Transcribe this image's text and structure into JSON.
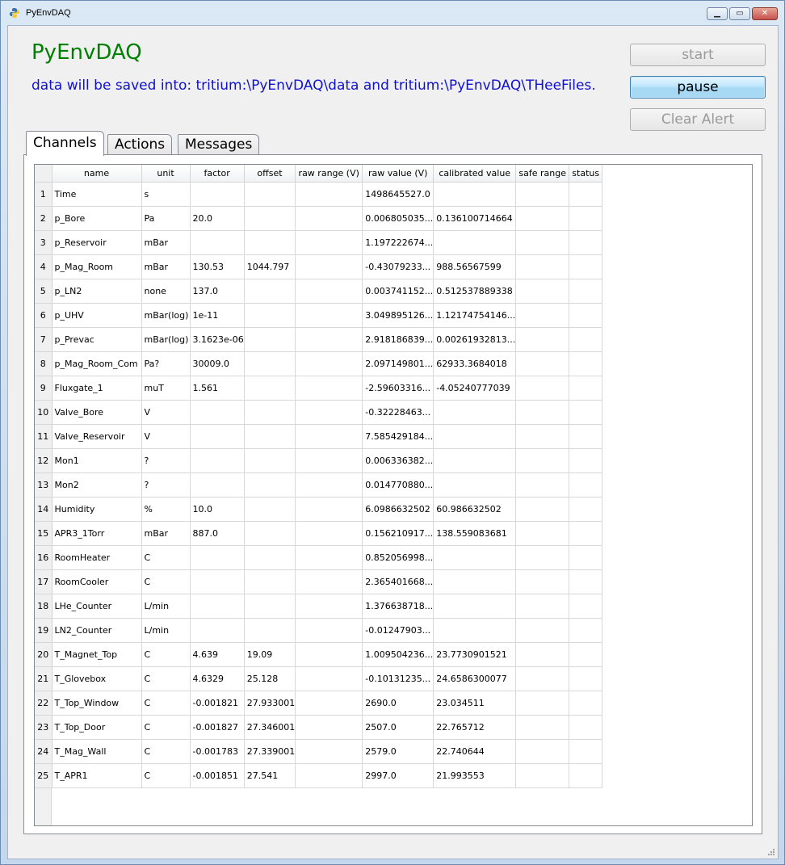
{
  "window": {
    "title": "PyEnvDAQ"
  },
  "header": {
    "app_title": "PyEnvDAQ",
    "save_info": "data will be saved into: tritium:\\PyEnvDAQ\\data and tritium:\\PyEnvDAQ\\THeeFiles."
  },
  "buttons": {
    "start": "start",
    "pause": "pause",
    "clear_alert": "Clear Alert"
  },
  "tabs": [
    {
      "label": "Channels",
      "active": true
    },
    {
      "label": "Actions",
      "active": false
    },
    {
      "label": "Messages",
      "active": false
    }
  ],
  "table": {
    "columns": [
      "name",
      "unit",
      "factor",
      "offset",
      "raw range (V)",
      "raw value (V)",
      "calibrated value",
      "safe range",
      "status"
    ],
    "rows": [
      [
        "1",
        "Time",
        "s",
        "",
        "",
        "",
        "1498645527.0",
        "",
        "",
        ""
      ],
      [
        "2",
        "p_Bore",
        "Pa",
        "20.0",
        "",
        "",
        "0.006805035...",
        "0.136100714664",
        "",
        ""
      ],
      [
        "3",
        "p_Reservoir",
        "mBar",
        "",
        "",
        "",
        "1.197222674...",
        "",
        "",
        ""
      ],
      [
        "4",
        "p_Mag_Room",
        "mBar",
        "130.53",
        "1044.797",
        "",
        "-0.43079233...",
        "988.56567599",
        "",
        ""
      ],
      [
        "5",
        "p_LN2",
        "none",
        "137.0",
        "",
        "",
        "0.003741152...",
        "0.512537889338",
        "",
        ""
      ],
      [
        "6",
        "p_UHV",
        "mBar(log)",
        "1e-11",
        "",
        "",
        "3.049895126...",
        "1.12174754146...",
        "",
        ""
      ],
      [
        "7",
        "p_Prevac",
        "mBar(log)",
        "3.1623e-06",
        "",
        "",
        "2.918186839...",
        "0.00261932813...",
        "",
        ""
      ],
      [
        "8",
        "p_Mag_Room_Com",
        "Pa?",
        "30009.0",
        "",
        "",
        "2.097149801...",
        "62933.3684018",
        "",
        ""
      ],
      [
        "9",
        "Fluxgate_1",
        "muT",
        "1.561",
        "",
        "",
        "-2.59603316...",
        "-4.05240777039",
        "",
        ""
      ],
      [
        "10",
        "Valve_Bore",
        "V",
        "",
        "",
        "",
        "-0.32228463...",
        "",
        "",
        ""
      ],
      [
        "11",
        "Valve_Reservoir",
        "V",
        "",
        "",
        "",
        "7.585429184...",
        "",
        "",
        ""
      ],
      [
        "12",
        "Mon1",
        "?",
        "",
        "",
        "",
        "0.006336382...",
        "",
        "",
        ""
      ],
      [
        "13",
        "Mon2",
        "?",
        "",
        "",
        "",
        "0.014770880...",
        "",
        "",
        ""
      ],
      [
        "14",
        "Humidity",
        "%",
        "10.0",
        "",
        "",
        "6.0986632502",
        "60.986632502",
        "",
        ""
      ],
      [
        "15",
        "APR3_1Torr",
        "mBar",
        "887.0",
        "",
        "",
        "0.156210917...",
        "138.559083681",
        "",
        ""
      ],
      [
        "16",
        "RoomHeater",
        "C",
        "",
        "",
        "",
        "0.852056998...",
        "",
        "",
        ""
      ],
      [
        "17",
        "RoomCooler",
        "C",
        "",
        "",
        "",
        "2.365401668...",
        "",
        "",
        ""
      ],
      [
        "18",
        "LHe_Counter",
        "L/min",
        "",
        "",
        "",
        "1.376638718...",
        "",
        "",
        ""
      ],
      [
        "19",
        "LN2_Counter",
        "L/min",
        "",
        "",
        "",
        "-0.01247903...",
        "",
        "",
        ""
      ],
      [
        "20",
        "T_Magnet_Top",
        "C",
        "4.639",
        "19.09",
        "",
        "1.009504236...",
        "23.7730901521",
        "",
        ""
      ],
      [
        "21",
        "T_Glovebox",
        "C",
        "4.6329",
        "25.128",
        "",
        "-0.10131235...",
        "24.6586300077",
        "",
        ""
      ],
      [
        "22",
        "T_Top_Window",
        "C",
        "-0.001821",
        "27.933001",
        "",
        "2690.0",
        "23.034511",
        "",
        ""
      ],
      [
        "23",
        "T_Top_Door",
        "C",
        "-0.001827",
        "27.346001",
        "",
        "2507.0",
        "22.765712",
        "",
        ""
      ],
      [
        "24",
        "T_Mag_Wall",
        "C",
        "-0.001783",
        "27.339001",
        "",
        "2579.0",
        "22.740644",
        "",
        ""
      ],
      [
        "25",
        "T_APR1",
        "C",
        "-0.001851",
        "27.541",
        "",
        "2997.0",
        "21.993553",
        "",
        ""
      ]
    ]
  },
  "icons": {
    "app": "python-icon",
    "minimize": "minimize-icon",
    "maximize": "maximize-icon",
    "close": "close-icon"
  },
  "colors": {
    "title": "#008000",
    "save_info": "#1010d0",
    "pause_button": "#a7d9f5"
  }
}
